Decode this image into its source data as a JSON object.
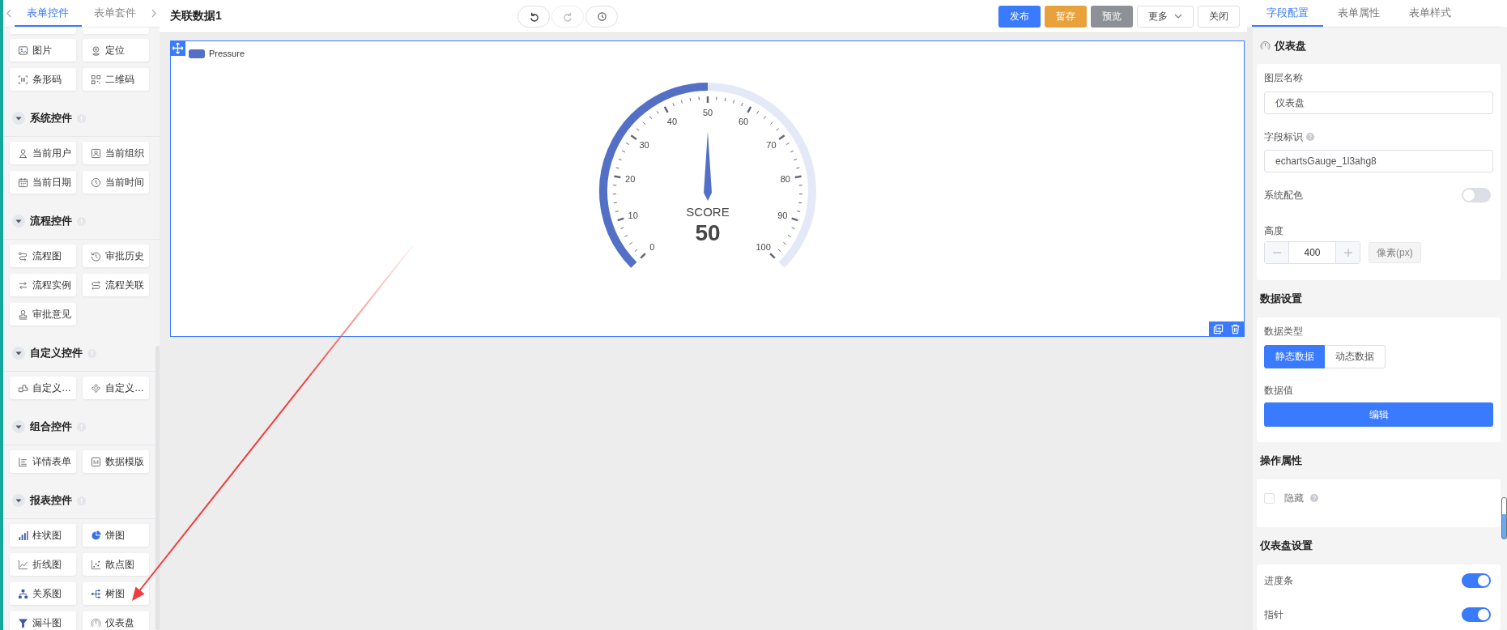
{
  "left_panel": {
    "tabs": [
      {
        "label": "表单控件",
        "selected": true
      },
      {
        "label": "表单套件",
        "selected": false
      }
    ],
    "groups": [
      {
        "items": [
          {
            "label": "图片"
          },
          {
            "label": "定位"
          },
          {
            "label": "条形码"
          },
          {
            "label": "二维码"
          }
        ]
      },
      {
        "title": "系统控件",
        "expanded": true,
        "items": [
          {
            "label": "当前用户"
          },
          {
            "label": "当前组织"
          },
          {
            "label": "当前日期"
          },
          {
            "label": "当前时间"
          }
        ]
      },
      {
        "title": "流程控件",
        "expanded": true,
        "items": [
          {
            "label": "流程图"
          },
          {
            "label": "审批历史"
          },
          {
            "label": "流程实例"
          },
          {
            "label": "流程关联"
          },
          {
            "label": "审批意见"
          }
        ]
      },
      {
        "title": "自定义控件",
        "expanded": true,
        "items": [
          {
            "label": "自定义…"
          },
          {
            "label": "自定义…"
          }
        ]
      },
      {
        "title": "组合控件",
        "expanded": true,
        "items": [
          {
            "label": "详情表单"
          },
          {
            "label": "数据模版"
          }
        ]
      },
      {
        "title": "报表控件",
        "expanded": true,
        "items": [
          {
            "label": "柱状图"
          },
          {
            "label": "饼图"
          },
          {
            "label": "折线图"
          },
          {
            "label": "散点图"
          },
          {
            "label": "关系图"
          },
          {
            "label": "树图"
          },
          {
            "label": "漏斗图"
          },
          {
            "label": "仪表盘"
          }
        ]
      }
    ]
  },
  "topbar": {
    "title": "关联数据1",
    "history": [
      {
        "disabled": false
      },
      {
        "disabled": true
      },
      {
        "disabled": false
      }
    ],
    "actions": [
      {
        "label": "发布",
        "kind": "primary"
      },
      {
        "label": "暂存",
        "kind": "warning"
      },
      {
        "label": "预览",
        "kind": "info"
      },
      {
        "label": "更多",
        "kind": "dropdown"
      },
      {
        "label": "关闭",
        "kind": "plain"
      }
    ]
  },
  "gauge": {
    "legend": "Pressure",
    "name": "SCORE",
    "value": "50",
    "level": 0.5,
    "axis_labels": [
      "0",
      "10",
      "20",
      "30",
      "40",
      "50",
      "60",
      "70",
      "80",
      "90",
      "100"
    ]
  },
  "right_panel": {
    "tabs": [
      {
        "label": "字段配置",
        "selected": true
      },
      {
        "label": "表单属性",
        "selected": false
      },
      {
        "label": "表单样式",
        "selected": false
      }
    ],
    "heading": "仪表盘",
    "layer_name": {
      "label": "图层名称",
      "value": "仪表盘"
    },
    "field_id": {
      "label": "字段标识",
      "value": "echartsGauge_1l3ahg8"
    },
    "system_color": {
      "label": "系统配色",
      "on": false
    },
    "height": {
      "label": "高度",
      "value": "400",
      "unit": "像素(px)"
    },
    "data_section": {
      "title": "数据设置",
      "type_label": "数据类型",
      "options": [
        {
          "label": "静态数据",
          "selected": true
        },
        {
          "label": "动态数据",
          "selected": false
        }
      ],
      "value_label": "数据值",
      "edit_button": "编辑"
    },
    "ops_section": {
      "title": "操作属性",
      "hidden": {
        "label": "隐藏",
        "checked": false
      }
    },
    "gauge_section": {
      "title": "仪表盘设置",
      "switches": [
        {
          "label": "进度条",
          "on": true
        },
        {
          "label": "指针",
          "on": true
        }
      ]
    }
  }
}
